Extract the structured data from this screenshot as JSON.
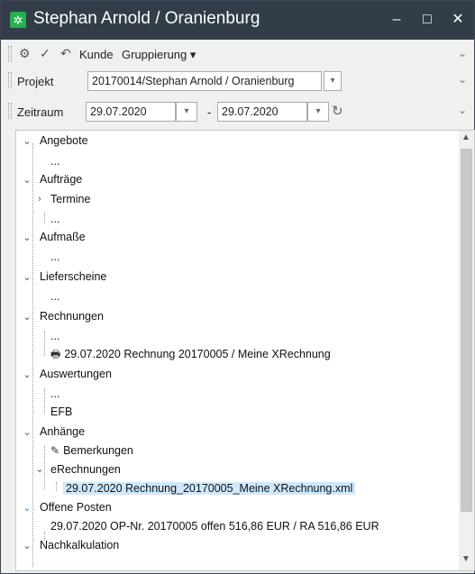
{
  "window": {
    "title": "Stephan Arnold / Oranienburg",
    "minimize": "–",
    "maximize": "□",
    "close": "✕"
  },
  "toolbar": {
    "customer_label": "Kunde",
    "grouping_label": "Gruppierung",
    "grouping_arrow": "▾"
  },
  "filters": {
    "project_label": "Projekt",
    "project_value": "20170014/Stephan Arnold / Oranienburg",
    "period_label": "Zeitraum",
    "date_from": "29.07.2020",
    "date_to": "29.07.2020",
    "separator": "-"
  },
  "tree": {
    "offers": "Angebote",
    "offers_child": "...",
    "orders": "Aufträge",
    "appointments": "Termine",
    "orders_child": "...",
    "measurements": "Aufmaße",
    "measurements_child": "...",
    "delivery_notes": "Lieferscheine",
    "delivery_notes_child": "...",
    "invoices": "Rechnungen",
    "invoices_child": "...",
    "invoice_item": "29.07.2020 Rechnung 20170005 / Meine XRechnung",
    "evaluations": "Auswertungen",
    "evaluations_child": "...",
    "efb": "EFB",
    "attachments": "Anhänge",
    "remarks": "Bemerkungen",
    "einvoices": "eRechnungen",
    "einvoice_file": "29.07.2020 Rechnung_20170005_Meine XRechnung.xml",
    "open_items": "Offene Posten",
    "open_item": "29.07.2020 OP-Nr. 20170005 offen 516,86 EUR / RA 516,86 EUR",
    "post_calc": "Nachkalkulation"
  },
  "colors": {
    "titlebar": "#323d49",
    "selection": "#cde8ff",
    "app_icon": "#22b14c"
  }
}
